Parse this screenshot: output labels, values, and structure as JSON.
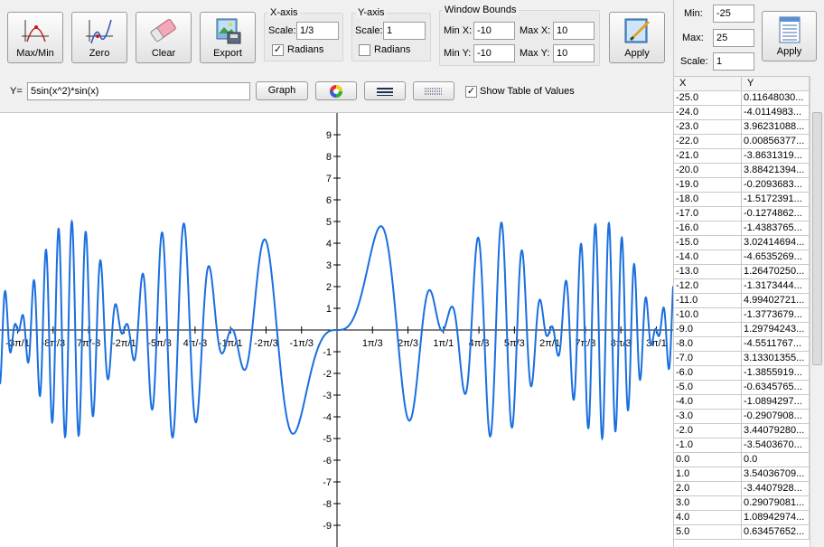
{
  "toolbar": {
    "maxmin_label": "Max/Min",
    "zero_label": "Zero",
    "clear_label": "Clear",
    "export_label": "Export",
    "apply_label": "Apply"
  },
  "xaxis": {
    "title": "X-axis",
    "scale_label": "Scale:",
    "scale_value": "1/3",
    "radians_label": "Radians",
    "radians_checked": true
  },
  "yaxis": {
    "title": "Y-axis",
    "scale_label": "Scale:",
    "scale_value": "1",
    "radians_label": "Radians",
    "radians_checked": false
  },
  "bounds": {
    "title": "Window Bounds",
    "minx_label": "Min X:",
    "minx_value": "-10",
    "maxx_label": "Max X:",
    "maxx_value": "10",
    "miny_label": "Min Y:",
    "miny_value": "-10",
    "maxy_label": "Max Y:",
    "maxy_value": "10"
  },
  "equation": {
    "label": "Y=",
    "value": "5sin(x^2)*sin(x)",
    "graph_label": "Graph",
    "show_table_label": "Show Table of Values",
    "show_table_checked": true
  },
  "table_settings": {
    "min_label": "Min:",
    "min_value": "-25",
    "max_label": "Max:",
    "max_value": "25",
    "scale_label": "Scale:",
    "scale_value": "1",
    "apply_label": "Apply"
  },
  "table": {
    "headers": [
      "X",
      "Y"
    ],
    "rows": [
      [
        "-25.0",
        "0.11648030..."
      ],
      [
        "-24.0",
        "-4.0114983..."
      ],
      [
        "-23.0",
        "3.96231088..."
      ],
      [
        "-22.0",
        "0.00856377..."
      ],
      [
        "-21.0",
        "-3.8631319..."
      ],
      [
        "-20.0",
        "3.88421394..."
      ],
      [
        "-19.0",
        "-0.2093683..."
      ],
      [
        "-18.0",
        "-1.5172391..."
      ],
      [
        "-17.0",
        "-0.1274862..."
      ],
      [
        "-16.0",
        "-1.4383765..."
      ],
      [
        "-15.0",
        "3.02414694..."
      ],
      [
        "-14.0",
        "-4.6535269..."
      ],
      [
        "-13.0",
        "1.26470250..."
      ],
      [
        "-12.0",
        "-1.3173444..."
      ],
      [
        "-11.0",
        "4.99402721..."
      ],
      [
        "-10.0",
        "-1.3773679..."
      ],
      [
        "-9.0",
        "1.29794243..."
      ],
      [
        "-8.0",
        "-4.5511767..."
      ],
      [
        "-7.0",
        "3.13301355..."
      ],
      [
        "-6.0",
        "-1.3855919..."
      ],
      [
        "-5.0",
        "-0.6345765..."
      ],
      [
        "-4.0",
        "-1.0894297..."
      ],
      [
        "-3.0",
        "-0.2907908..."
      ],
      [
        "-2.0",
        "3.44079280..."
      ],
      [
        "-1.0",
        "-3.5403670..."
      ],
      [
        "0.0",
        "0.0"
      ],
      [
        "1.0",
        "3.54036709..."
      ],
      [
        "2.0",
        "-3.4407928..."
      ],
      [
        "3.0",
        "0.29079081..."
      ],
      [
        "4.0",
        "1.08942974..."
      ],
      [
        "5.0",
        "0.63457652..."
      ]
    ]
  },
  "graph": {
    "x_tick_labels_left": [
      "-3π/1",
      "-8π/3",
      "7π/-3",
      "-2π/1",
      "-5π/3",
      "4π/-3",
      "-1π/1",
      "-2π/3",
      "-1π/3"
    ],
    "x_tick_labels_right": [
      "1π/3",
      "2π/3",
      "1π/1",
      "4π/3",
      "5π/3",
      "2π/1",
      "7π/3",
      "8π/3",
      "3π/1"
    ],
    "y_tick_labels_pos": [
      "1",
      "2",
      "3",
      "4",
      "5",
      "6",
      "7",
      "8",
      "9"
    ],
    "y_tick_labels_neg": [
      "-1",
      "-2",
      "-3",
      "-4",
      "-5",
      "-6",
      "-7",
      "-8",
      "-9"
    ],
    "curve_color": "#1a6fe0"
  },
  "icons": [
    "maxmin-icon",
    "zero-icon",
    "eraser-icon",
    "export-icon",
    "apply-icon",
    "color-wheel-icon",
    "line-thick-icon",
    "line-dotted-icon",
    "table-apply-icon"
  ]
}
